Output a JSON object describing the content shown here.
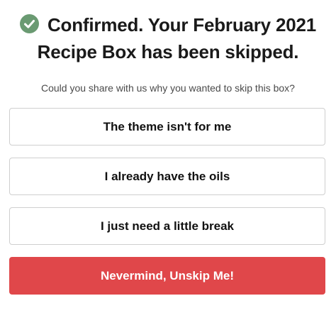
{
  "header": {
    "icon": "check-circle-icon",
    "title_line1": "Confirmed. Your February 2021",
    "title_line2": "Recipe Box has been skipped."
  },
  "subtitle": "Could you share with us why you wanted to skip this box?",
  "options": [
    {
      "label": "The theme isn't for me"
    },
    {
      "label": "I already have the oils"
    },
    {
      "label": "I just need a little break"
    }
  ],
  "unskip_button": {
    "label": "Nevermind, Unskip Me!"
  },
  "colors": {
    "accent_green": "#6a9a72",
    "button_red": "#e0474a"
  }
}
